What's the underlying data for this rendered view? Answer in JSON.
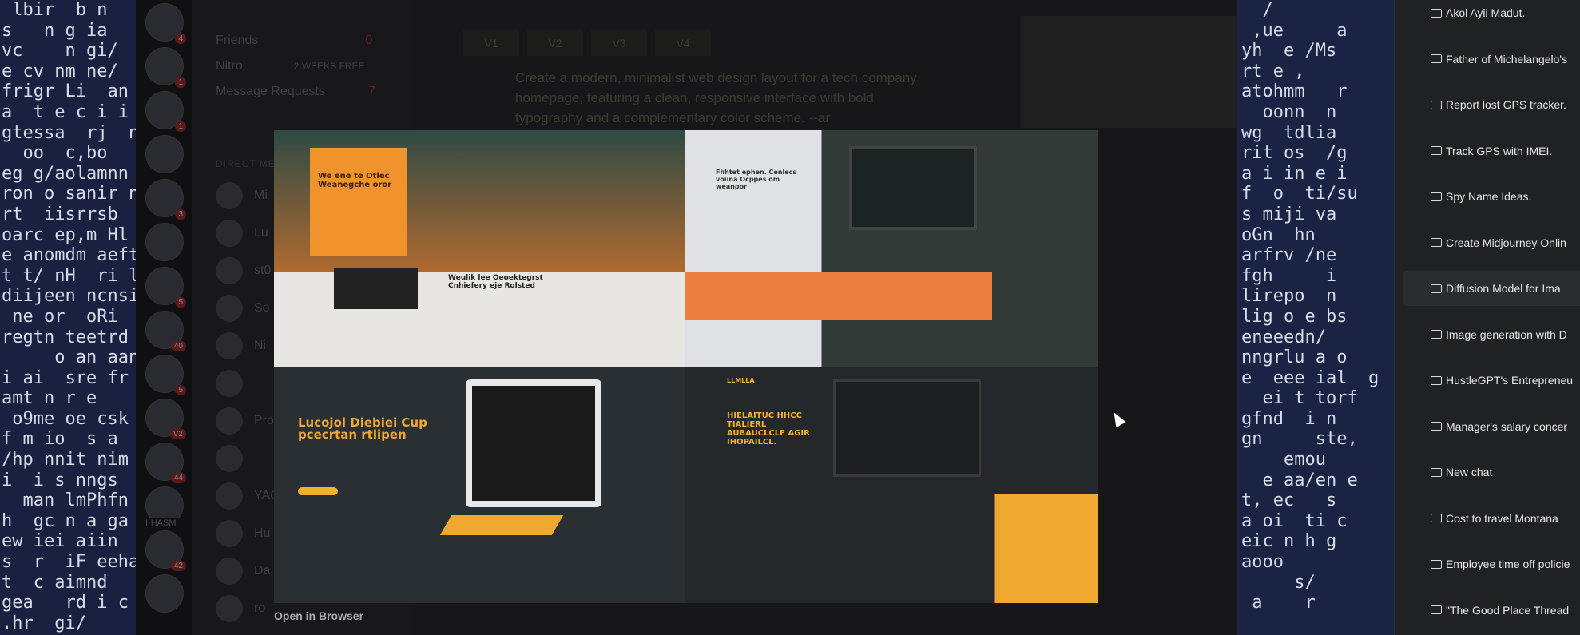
{
  "terminal_left": {
    "lines": [
      " lbir  b n",
      "s   n g ia",
      "vc    n gi/",
      "e cv nm ne/",
      "frigr Li  an",
      "a  t e c i i",
      "gtessa  rj  n",
      "  oo  c,bo",
      "eg g/aolamnn",
      "ron o sanir n",
      "rt  iisrrsb",
      "oarc ep,m Hl",
      "e anomdm aeft",
      "t t/ nH  ri l",
      "diijeen ncnsi",
      " ne or  oRi",
      "regtn teetrd",
      "     o an aan",
      "i ai  sre fr",
      "amt n r e",
      " o9me oe csk",
      "f m io  s a",
      "/hp nnit nim",
      "i  i s nngs",
      "  man lmPhfn",
      "h  gc n a ga",
      "ew iei aiin",
      "s  r  iF eeha",
      "t  c aimnd",
      "gea   rd i c",
      ".hr  gi/"
    ]
  },
  "terminal_right": {
    "lines": [
      "  /",
      " ,ue     a",
      "yh  e /Ms",
      "rt e ,",
      "atohmm   r",
      "  oonn  n",
      "wg  tdlia",
      "rit os  /g",
      "a i in e i",
      "f  o  ti/su",
      "s miji va",
      "oGn  hn",
      "arfrv /ne",
      "fgh     i",
      "lirepo  n",
      "lig o e bs",
      "eneeedn/",
      "nngrlu a o",
      "e  eee ial  g",
      "  ei t torf",
      "gfnd  i n",
      "gn     ste,",
      "    emou",
      "  e aa/en e",
      "t, ec   s",
      "a oi  ti c",
      "eic n h g",
      "aooo",
      "     s/",
      " a    r"
    ]
  },
  "discord": {
    "dm_nav": [
      {
        "label": "Friends",
        "badge": "0"
      },
      {
        "label": "Nitro",
        "badge": "2 WEEKS FREE"
      },
      {
        "label": "Message Requests",
        "badge": "7"
      }
    ],
    "dm_header": "DIRECT MESSAGES",
    "dm_names": [
      "Mi",
      "Lu",
      "st0",
      "So",
      "Ni",
      "",
      "Pro",
      "",
      "YAC",
      "Hu",
      "Da",
      "ro"
    ],
    "server_badges": [
      "4",
      "1",
      "1",
      "",
      "3",
      "",
      "5",
      "40",
      "5",
      "V2",
      "44",
      "",
      "42",
      ""
    ],
    "server_label": "I·HASM",
    "version_tabs": [
      "V1",
      "V2",
      "V3",
      "V4"
    ],
    "prompt": "Create a modern, minimalist web design layout for a tech company homepage, featuring a clean, responsive interface with bold typography and a complementary color scheme. --ar"
  },
  "modal": {
    "q1_heading": "We ene te Otlec Weanegche oror",
    "q1_sub": "Weulik lee Oeoektegrst Cnhiefery eje Rolsted",
    "q2_heading": "Fhhtet ephen. Cenlecs vouna Ocppes om weanpor",
    "q3_heading": "Lucojol Diebiei Cup pcecrtan rtlipen",
    "q4_logo": "LLMLLA",
    "q4_heading": "HIELAITUC HHCC TIALIERL AUBAUCLCLF AGIR IHOPAILCL.",
    "open_in_browser": "Open in Browser",
    "accent": "#f0932c"
  },
  "chatgpt": {
    "conversations": [
      "Akol Ayii Madut.",
      "Father of Michelangelo's",
      "Report lost GPS tracker.",
      "Track GPS with IMEI.",
      "Spy Name Ideas.",
      "Create Midjourney Onlin",
      "Diffusion Model for Ima",
      "Image generation with D",
      "HustleGPT's Entrepreneu",
      "Manager's salary concer",
      "New chat",
      "Cost to travel Montana",
      "Employee time off policie",
      "\"The Good Place Thread"
    ],
    "active_index": 6
  }
}
